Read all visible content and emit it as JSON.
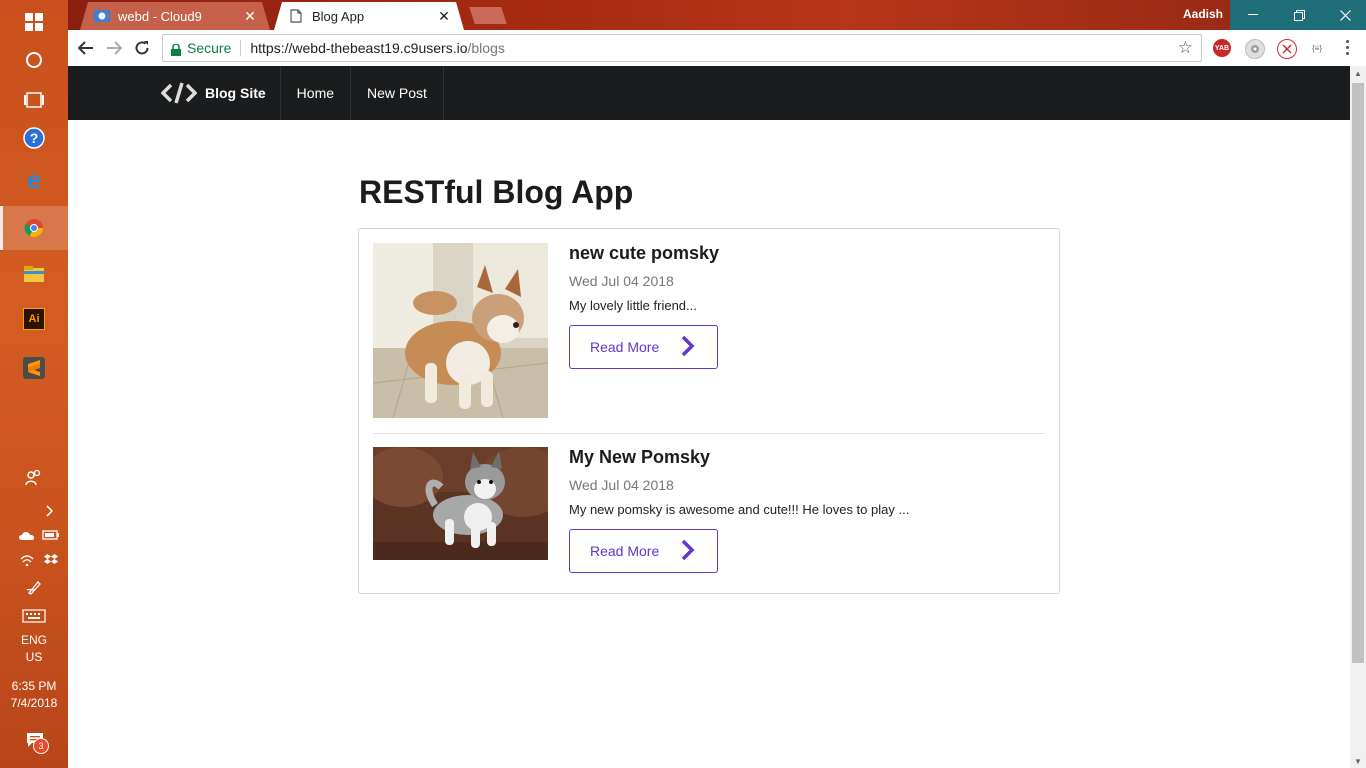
{
  "taskbar": {
    "icons": [
      "windows-start-icon",
      "cortana-icon",
      "task-view-icon",
      "help-icon",
      "edge-icon",
      "chrome-icon",
      "file-explorer-icon",
      "illustrator-icon",
      "sublime-icon"
    ],
    "illustrator_label": "Ai",
    "language_line1": "ENG",
    "language_line2": "US",
    "time": "6:35 PM",
    "date": "7/4/2018",
    "notification_count": "3"
  },
  "browser": {
    "tabs": [
      {
        "label": "webd - Cloud9",
        "close": "✕"
      },
      {
        "label": "Blog App",
        "close": "✕"
      }
    ],
    "user": "Aadish",
    "secure_label": "Secure",
    "url_host": "https://webd-thebeast19.c9users.io",
    "url_path": "/blogs",
    "extensions": {
      "yab": "YAB",
      "braces": "{≡}"
    }
  },
  "navbar": {
    "brand": "Blog Site",
    "items": [
      "Home",
      "New Post"
    ]
  },
  "main": {
    "heading": "RESTful Blog App",
    "posts": [
      {
        "title": "new cute pomsky",
        "date": "Wed Jul 04 2018",
        "body": "My lovely little friend...",
        "button": "Read More"
      },
      {
        "title": "My New Pomsky",
        "date": "Wed Jul 04 2018",
        "body": "My new pomsky is awesome and cute!!! He loves to play ...",
        "button": "Read More"
      }
    ]
  },
  "colors": {
    "taskbar": "#c8501c",
    "titlebar": "#a52a12",
    "navbar": "#1b1c1d",
    "accent": "#6435c9",
    "secure": "#0b8043"
  }
}
